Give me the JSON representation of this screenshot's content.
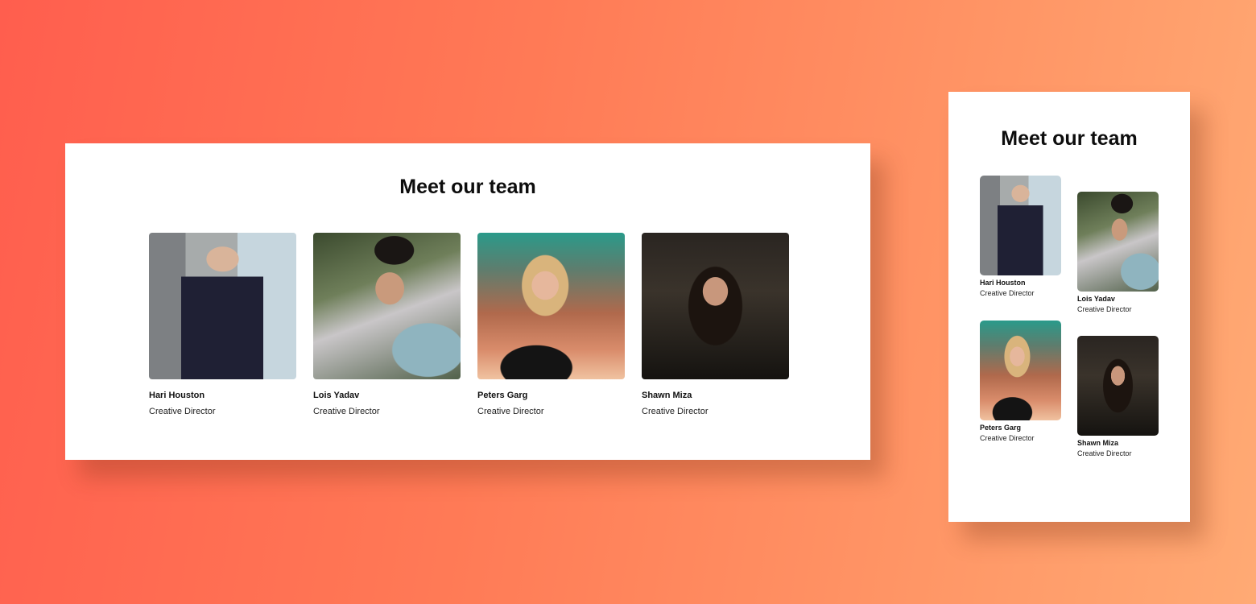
{
  "desktop": {
    "title": "Meet our team",
    "members": [
      {
        "name": "Hari Houston",
        "role": "Creative Director",
        "photo": "man-in-suit-photo"
      },
      {
        "name": "Lois Yadav",
        "role": "Creative Director",
        "photo": "man-in-tshirt-photo"
      },
      {
        "name": "Peters Garg",
        "role": "Creative Director",
        "photo": "blonde-woman-photo"
      },
      {
        "name": "Shawn Miza",
        "role": "Creative Director",
        "photo": "dark-hair-woman-photo"
      }
    ]
  },
  "mobile": {
    "title": "Meet our team",
    "members": [
      {
        "name": "Hari Houston",
        "role": "Creative Director",
        "photo": "man-in-suit-photo"
      },
      {
        "name": "Lois Yadav",
        "role": "Creative Director",
        "photo": "man-in-tshirt-photo"
      },
      {
        "name": "Peters Garg",
        "role": "Creative Director",
        "photo": "blonde-woman-photo"
      },
      {
        "name": "Shawn Miza",
        "role": "Creative Director",
        "photo": "dark-hair-woman-photo"
      }
    ]
  }
}
